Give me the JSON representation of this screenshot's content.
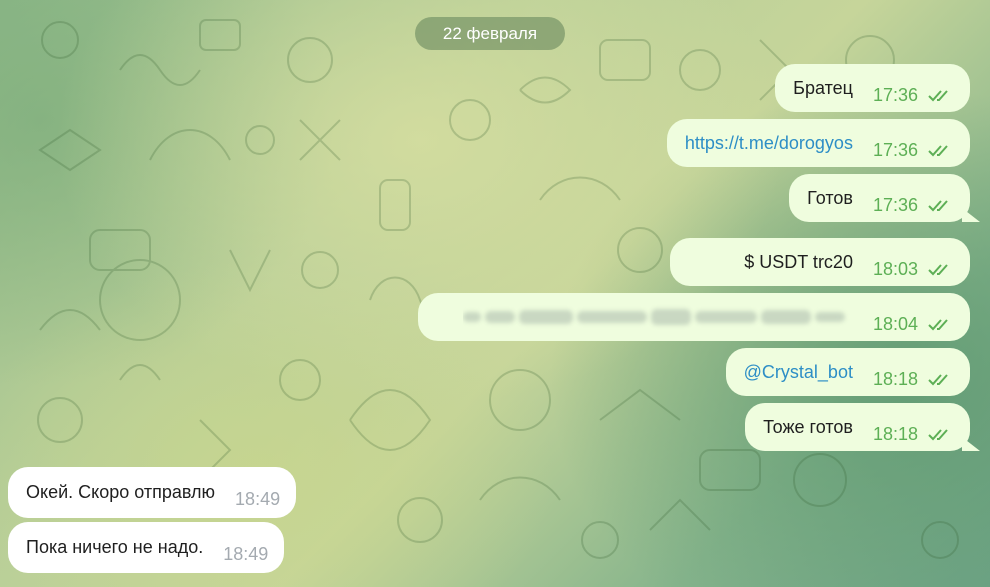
{
  "chat": {
    "date_separator": "22 февраля",
    "messages": [
      {
        "direction": "out",
        "text": "Братец",
        "time": "17:36",
        "status": "read"
      },
      {
        "direction": "out",
        "text": "https://t.me/dorogyos",
        "time": "17:36",
        "status": "read",
        "is_link": true
      },
      {
        "direction": "out",
        "text": "Готов",
        "time": "17:36",
        "status": "read"
      },
      {
        "direction": "out",
        "text": "$ USDT trc20",
        "time": "18:03",
        "status": "read"
      },
      {
        "direction": "out",
        "text": "",
        "time": "18:04",
        "status": "read",
        "redacted": true
      },
      {
        "direction": "out",
        "text": "@Crystal_bot",
        "time": "18:18",
        "status": "read",
        "is_link": true
      },
      {
        "direction": "out",
        "text": "Тоже готов",
        "time": "18:18",
        "status": "read"
      },
      {
        "direction": "in",
        "text": "Окей. Скоро отправлю",
        "time": "18:49"
      },
      {
        "direction": "in",
        "text": "Пока ничего не надо.",
        "time": "18:49"
      }
    ]
  },
  "colors": {
    "outgoing_bubble": "#effdde",
    "incoming_bubble": "#ffffff",
    "outgoing_time": "#5daf55",
    "incoming_time": "#a4aab0",
    "link": "#2d8ec6",
    "date_pill": "#60825880"
  },
  "icons": {
    "read_status": "double-check-icon"
  }
}
